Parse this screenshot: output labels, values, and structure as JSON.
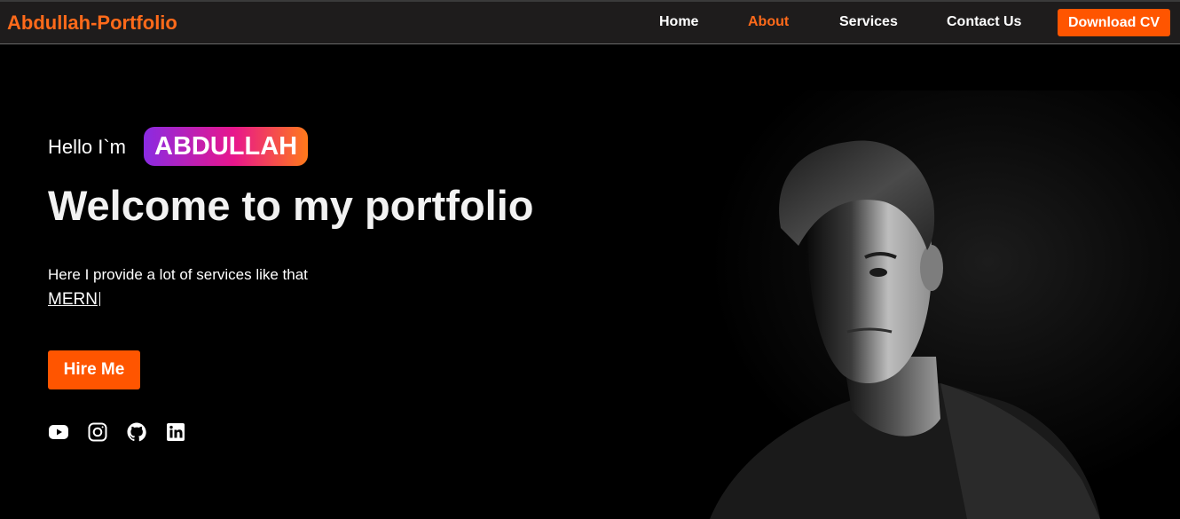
{
  "navbar": {
    "brand": "Abdullah-Portfolio",
    "links": [
      {
        "label": "Home",
        "active": false
      },
      {
        "label": "About",
        "active": true
      },
      {
        "label": "Services",
        "active": false
      },
      {
        "label": "Contact Us",
        "active": false
      }
    ],
    "download_cv_label": "Download CV"
  },
  "hero": {
    "greeting": "Hello I`m",
    "name": "ABDULLAH",
    "headline": "Welcome to my portfolio",
    "services_text": "Here I provide a lot of services like that",
    "typed_word": "MERN",
    "hire_label": "Hire Me",
    "socials": [
      "youtube-icon",
      "instagram-icon",
      "github-icon",
      "linkedin-icon"
    ]
  },
  "colors": {
    "accent": "#ff5500",
    "brand_text": "#ff6a1a",
    "navbar_bg": "#1e1c1c",
    "page_bg": "#000000",
    "badge_gradient": [
      "#8a2be2",
      "#e8168c",
      "#ff7a1a"
    ]
  }
}
